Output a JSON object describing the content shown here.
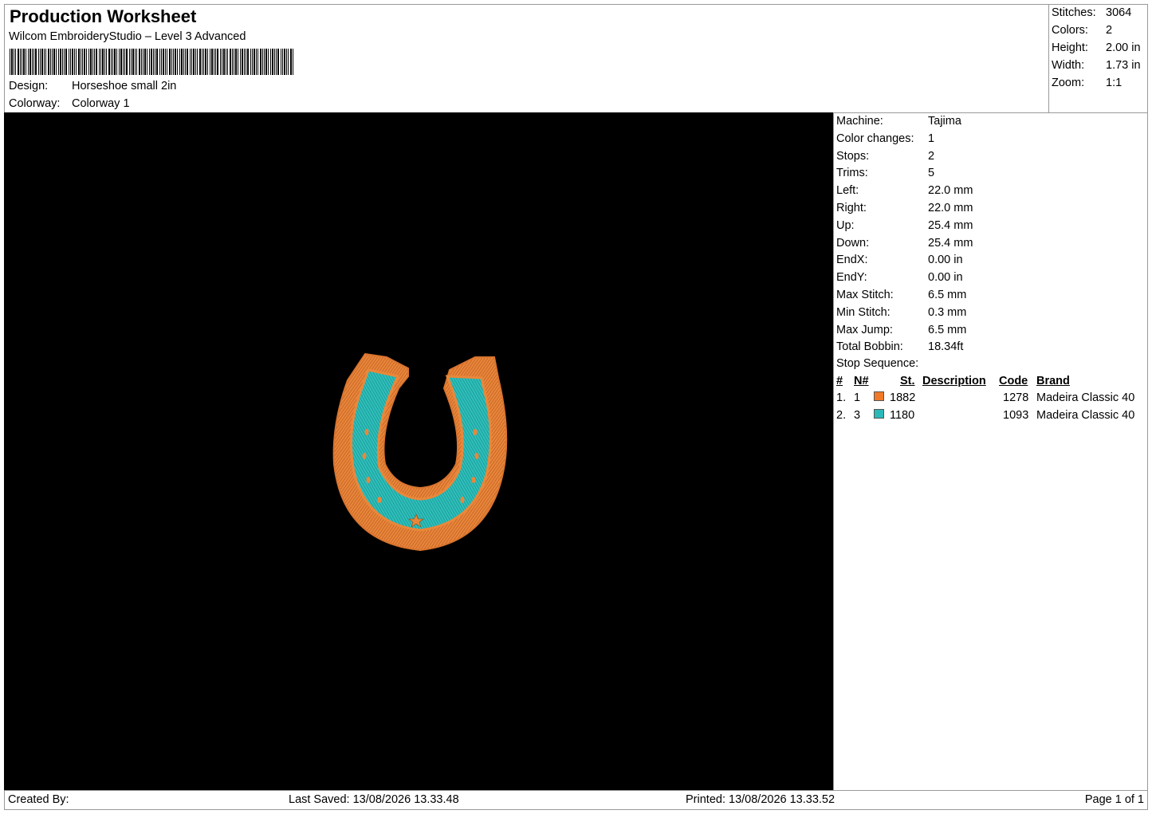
{
  "header": {
    "title": "Production Worksheet",
    "software": "Wilcom EmbroideryStudio – Level 3 Advanced",
    "design_label": "Design:",
    "design_value": "Horseshoe small 2in",
    "colorway_label": "Colorway:",
    "colorway_value": "Colorway 1"
  },
  "stats": [
    {
      "label": "Stitches:",
      "value": "3064"
    },
    {
      "label": "Colors:",
      "value": "2"
    },
    {
      "label": "Height:",
      "value": "2.00 in"
    },
    {
      "label": "Width:",
      "value": "1.73 in"
    },
    {
      "label": "Zoom:",
      "value": "1:1"
    }
  ],
  "info": [
    {
      "label": "Machine:",
      "value": "Tajima"
    },
    {
      "label": "Color changes:",
      "value": "1"
    },
    {
      "label": "Stops:",
      "value": "2"
    },
    {
      "label": "Trims:",
      "value": "5"
    },
    {
      "label": "Left:",
      "value": "22.0 mm"
    },
    {
      "label": "Right:",
      "value": "22.0 mm"
    },
    {
      "label": "Up:",
      "value": "25.4 mm"
    },
    {
      "label": "Down:",
      "value": "25.4 mm"
    },
    {
      "label": "EndX:",
      "value": "0.00 in"
    },
    {
      "label": "EndY:",
      "value": "0.00 in"
    },
    {
      "label": "Max Stitch:",
      "value": "6.5 mm"
    },
    {
      "label": "Min Stitch:",
      "value": "0.3 mm"
    },
    {
      "label": "Max Jump:",
      "value": "6.5 mm"
    },
    {
      "label": "Total Bobbin:",
      "value": "18.34ft"
    }
  ],
  "stop_sequence": {
    "title": "Stop Sequence:",
    "headers": {
      "num": "#",
      "n": "N#",
      "st": "St.",
      "description": "Description",
      "code": "Code",
      "brand": "Brand"
    },
    "rows": [
      {
        "num": "1.",
        "n": "1",
        "color": "#F07A28",
        "st": "1882",
        "description": "",
        "code": "1278",
        "brand": "Madeira Classic 40"
      },
      {
        "num": "2.",
        "n": "3",
        "color": "#2BB8B8",
        "st": "1180",
        "description": "",
        "code": "1093",
        "brand": "Madeira Classic 40"
      }
    ]
  },
  "design_colors": {
    "outline": "#E9873A",
    "fill": "#2FC0BC",
    "background": "#000000"
  },
  "footer": {
    "created_by": "Created By:",
    "last_saved": "Last Saved: 13/08/2026 13.33.48",
    "printed": "Printed: 13/08/2026 13.33.52",
    "page": "Page 1 of 1"
  }
}
